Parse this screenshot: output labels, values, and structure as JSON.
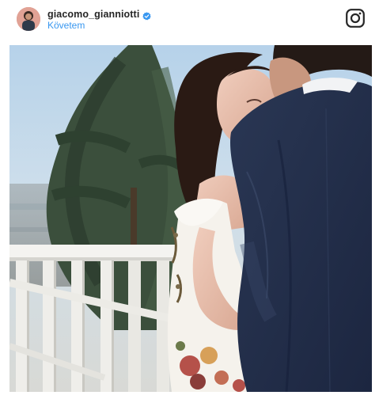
{
  "post": {
    "username": "giacomo_gianniotti",
    "follow_label": "Követem"
  },
  "icons": {
    "avatar": "profile-avatar",
    "verified": "verified-badge-icon",
    "brand": "instagram-logo-icon"
  },
  "colors": {
    "link": "#3897f0",
    "username": "#262626",
    "verified": "#3897f0"
  }
}
